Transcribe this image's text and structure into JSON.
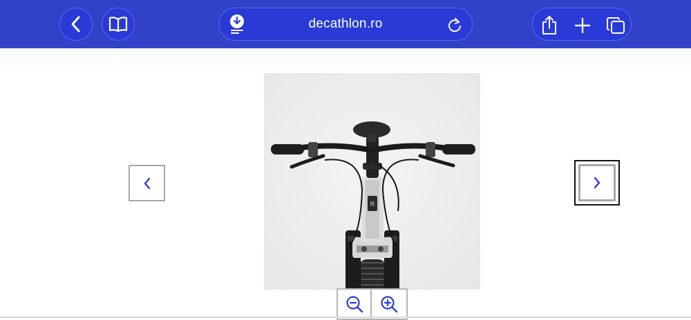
{
  "browser": {
    "url": "decathlon.ro",
    "toolbar_color": "#3142c8",
    "icons": {
      "back": "chevron-left-icon",
      "reader": "book-icon",
      "download": "download-icon",
      "reload": "reload-icon",
      "share": "share-icon",
      "new_tab": "plus-icon",
      "tabs": "tabs-icon"
    }
  },
  "gallery": {
    "image_subject": "bicycle-front-view",
    "prev_icon": "chevron-left-icon",
    "next_icon": "chevron-right-icon",
    "zoom_out_icon": "zoom-out-icon",
    "zoom_in_icon": "zoom-in-icon",
    "accent_color": "#2a3ad6"
  }
}
